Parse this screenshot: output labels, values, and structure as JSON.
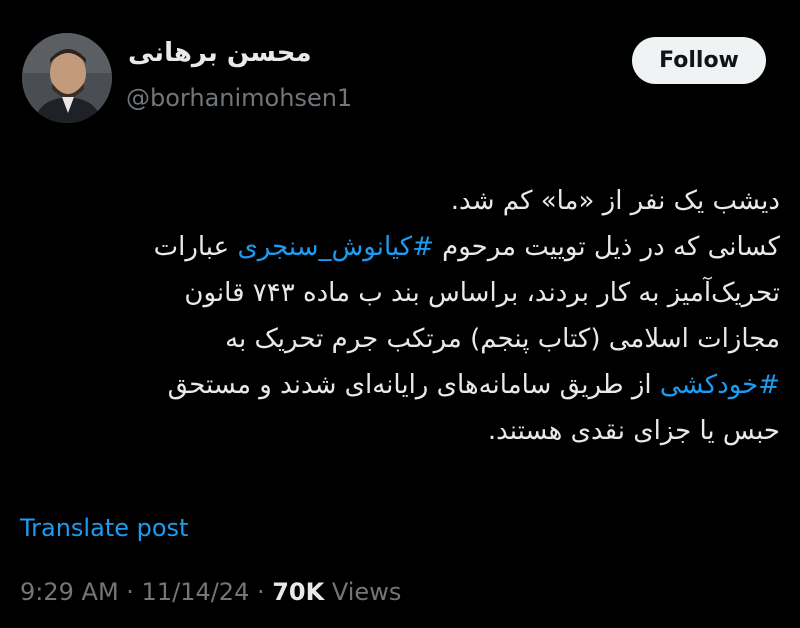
{
  "author": {
    "display_name": "محسن برهانی",
    "handle": "@borhanimohsen1"
  },
  "follow_label": "Follow",
  "tweet": {
    "line1": "دیشب یک نفر از «ما» کم شد.",
    "line2_prefix": "کسانی که در ذیل توییت مرحوم ",
    "hashtag1": "#کیانوش_سنجری",
    "line2_suffix": " عبارات",
    "line3": "تحریک‌آمیز به کار بردند، براساس بند ب ماده ۷۴۳ قانون",
    "line4": "مجازات اسلامی (کتاب پنجم) مرتکب جرم تحریک به",
    "hashtag2": "#خودکشی",
    "line5_suffix": " از طریق سامانه‌های رایانه‌ای شدند و مستحق",
    "line6": "حبس یا جزای نقدی هستند."
  },
  "translate_label": "Translate post",
  "meta": {
    "time": "9:29 AM",
    "separator1": " · ",
    "date": "11/14/24",
    "separator2": " · ",
    "views_count": "70K",
    "views_label": " Views"
  },
  "colors": {
    "background": "#000000",
    "text": "#e7e9ea",
    "muted": "#71767b",
    "link": "#1d9bf0",
    "follow_bg": "#eff3f4"
  }
}
